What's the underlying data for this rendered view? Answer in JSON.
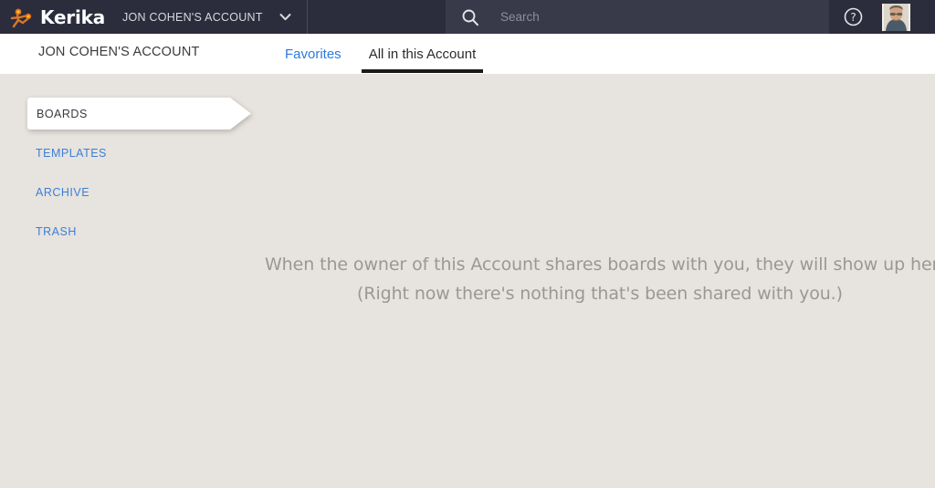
{
  "topbar": {
    "brand_name": "Kerika",
    "logo_icon": "kerika-people-icon",
    "account_selector_label": "JON COHEN'S ACCOUNT",
    "account_caret_icon": "chevron-down-icon",
    "search": {
      "icon": "search-icon",
      "value": "",
      "placeholder": "Search"
    },
    "help_icon": "question-circle-icon",
    "avatar_icon": "user-avatar-photo"
  },
  "subheader": {
    "title": "JON COHEN'S ACCOUNT",
    "tabs": [
      {
        "label": "Favorites",
        "active": false
      },
      {
        "label": "All in this Account",
        "active": true
      }
    ]
  },
  "sidebar": {
    "items": [
      {
        "label": "BOARDS",
        "active": true
      },
      {
        "label": "TEMPLATES",
        "active": false
      },
      {
        "label": "ARCHIVE",
        "active": false
      },
      {
        "label": "TRASH",
        "active": false
      }
    ]
  },
  "main": {
    "empty_state": {
      "line1": "When the owner of this Account shares boards with you, they will show up here.",
      "line2": "(Right now there's nothing that's been shared with you.)"
    }
  },
  "colors": {
    "topbar_bg": "#2b2d3c",
    "search_bg": "#383a4a",
    "page_bg": "#e7e3de",
    "link_blue": "#3d7fd6",
    "tab_link_blue": "#2c7ae0",
    "logo_orange": "#e2701e",
    "logo_yellow": "#ffd21e",
    "muted_text": "#9b9891"
  }
}
